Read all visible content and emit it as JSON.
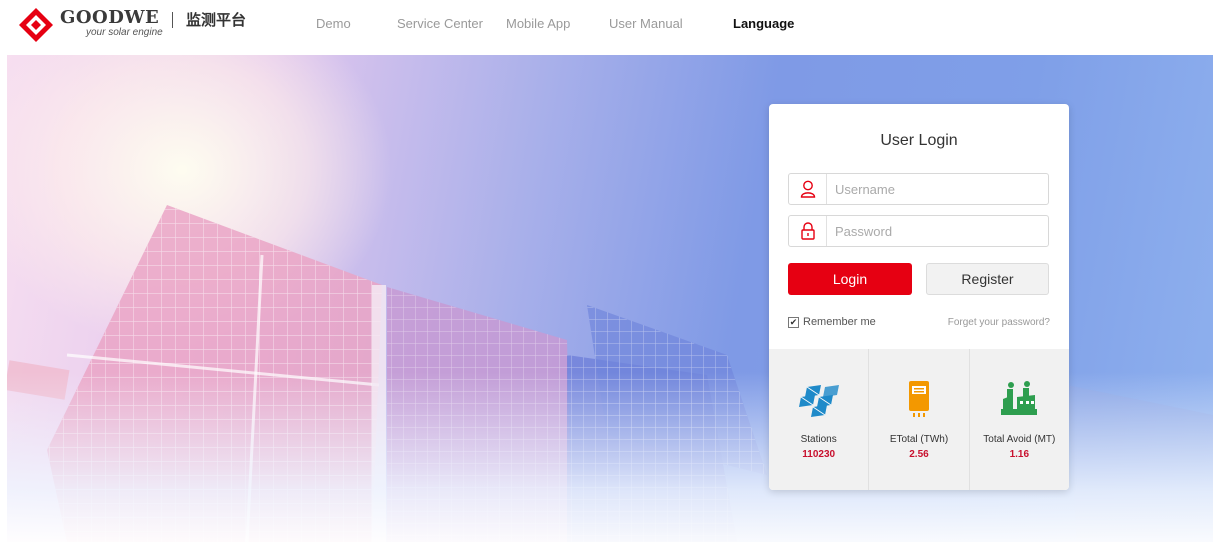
{
  "header": {
    "brand": "GOODWE",
    "tagline": "your solar engine",
    "platform": "监测平台",
    "nav": [
      "Demo",
      "Service Center",
      "Mobile App",
      "User Manual"
    ],
    "language_label": "Language"
  },
  "login": {
    "title": "User Login",
    "username_placeholder": "Username",
    "password_placeholder": "Password",
    "login_button": "Login",
    "register_button": "Register",
    "remember_label": "Remember me",
    "remember_checked": true,
    "forget_link": "Forget your password?"
  },
  "stats": [
    {
      "label": "Stations",
      "value": "110230",
      "icon": "solar-panel-icon"
    },
    {
      "label": "ETotal (TWh)",
      "value": "2.56",
      "icon": "inverter-icon"
    },
    {
      "label": "Total Avoid (MT)",
      "value": "1.16",
      "icon": "factory-icon"
    }
  ],
  "colors": {
    "accent": "#e60012",
    "value_red": "#c8102e",
    "icon_blue": "#1f8ac9",
    "icon_orange": "#f39800",
    "icon_green": "#2e9e4f"
  }
}
